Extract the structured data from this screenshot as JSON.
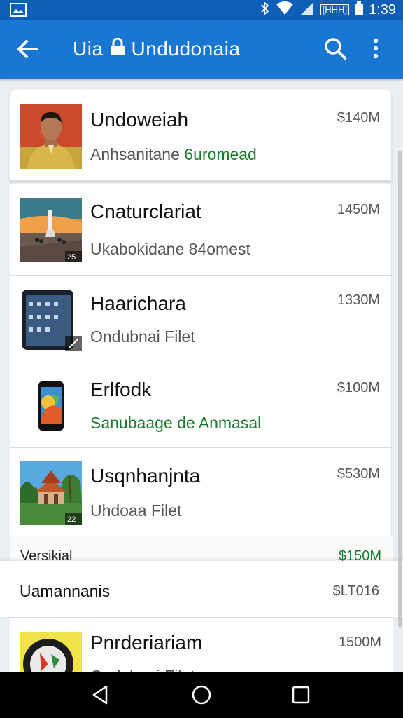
{
  "status_bar": {
    "time": "1:39",
    "badge": "[HHH]"
  },
  "app_bar": {
    "title_left": "Uia",
    "title_right": "Undudonaia"
  },
  "items": [
    {
      "name": "Undoweiah",
      "sub_plain": "Anhsanitane",
      "sub_green": "6uromead",
      "size": "$140M",
      "thumb": "portrait"
    },
    {
      "name": "Cnaturclariat",
      "sub_plain": "Ukabokidane 84omest",
      "sub_green": "",
      "size": "1450M",
      "thumb": "landmark",
      "badge": "25"
    },
    {
      "name": "Haarichara",
      "sub_plain": "Ondubnai Filet",
      "sub_green": "",
      "size": "1330M",
      "thumb": "tablet"
    },
    {
      "name": "Erlfodk",
      "sub_plain": "",
      "sub_green": "Sanubaage de Anmasal",
      "size": "$100M",
      "thumb": "phone"
    },
    {
      "name": "Usqnhanjnta",
      "sub_plain": "Uhdoaa Filet",
      "sub_green": "",
      "size": "$530M",
      "thumb": "temple",
      "badge": "22"
    }
  ],
  "section": {
    "label": "Versikial",
    "amount": "$150M"
  },
  "summary": {
    "label": "Uamannanis",
    "amount": "$LT016"
  },
  "last_item": {
    "name": "Pnrderiariam",
    "size": "1500M",
    "sub_partial": "Ondubnai Filet"
  },
  "colors": {
    "status_bar": "#0d5fb8",
    "app_bar": "#1976d2",
    "accent_green": "#1b7a2e"
  }
}
